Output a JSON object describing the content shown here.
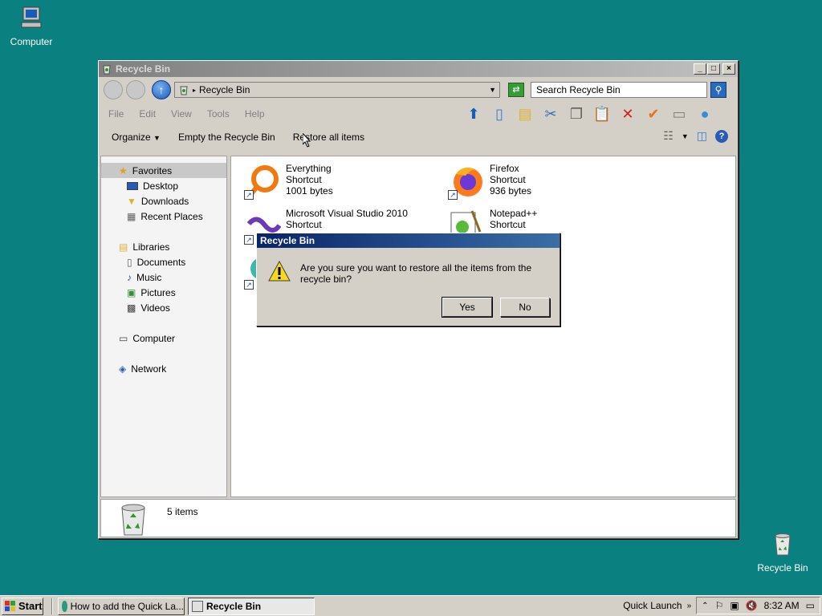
{
  "desktop": {
    "computer_label": "Computer",
    "recycle_label": "Recycle Bin"
  },
  "window": {
    "title": "Recycle Bin",
    "address": "Recycle Bin",
    "search_placeholder": "Search Recycle Bin",
    "menu": [
      "File",
      "Edit",
      "View",
      "Tools",
      "Help"
    ],
    "commands": {
      "organize": "Organize",
      "empty": "Empty the Recycle Bin",
      "restore_all": "Restore all items"
    },
    "sidebar": {
      "favorites": "Favorites",
      "desktop": "Desktop",
      "downloads": "Downloads",
      "recent": "Recent Places",
      "libraries": "Libraries",
      "documents": "Documents",
      "music": "Music",
      "pictures": "Pictures",
      "videos": "Videos",
      "computer": "Computer",
      "network": "Network"
    },
    "files": [
      {
        "name": "Everything",
        "type": "Shortcut",
        "size": "1001 bytes"
      },
      {
        "name": "Firefox",
        "type": "Shortcut",
        "size": "936 bytes"
      },
      {
        "name": "Microsoft Visual Studio 2010",
        "type": "Shortcut",
        "size": ""
      },
      {
        "name": "Notepad++",
        "type": "Shortcut",
        "size": ""
      }
    ],
    "status_count": "5 items"
  },
  "dialog": {
    "title": "Recycle Bin",
    "message": "Are you sure you want to restore all the items from the recycle bin?",
    "yes": "Yes",
    "no": "No"
  },
  "taskbar": {
    "start": "Start",
    "task1": "How to add the Quick La...",
    "task2": "Recycle Bin",
    "quick_launch": "Quick Launch",
    "clock": "8:32 AM"
  },
  "colors": {
    "desktop": "#0a8080",
    "dialog_title": "#0a246a",
    "window_face": "#d4d0c8"
  }
}
